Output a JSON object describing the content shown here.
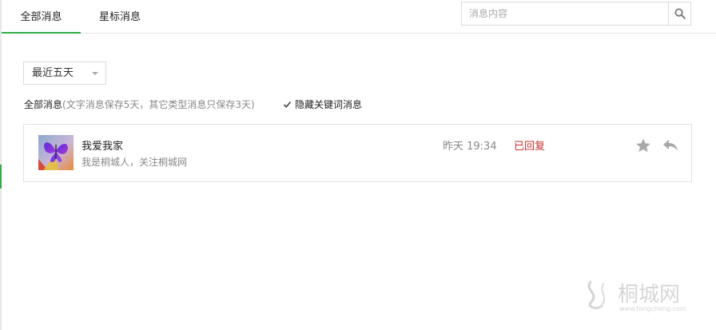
{
  "tabs": [
    {
      "label": "全部消息",
      "active": true
    },
    {
      "label": "星标消息",
      "active": false
    }
  ],
  "search": {
    "placeholder": "消息内容",
    "value": ""
  },
  "filter": {
    "range_selected": "最近五天",
    "title": "全部消息",
    "note": "(文字消息保存5天，其它类型消息只保存3天)",
    "hide_keyword_label": "隐藏关键词消息",
    "hide_keyword_checked": true
  },
  "messages": [
    {
      "sender": "我爱我家",
      "preview": "我是桐城人，关注桐城网",
      "time": "昨天 19:34",
      "status": "已回复"
    }
  ],
  "watermark": {
    "name": "桐城网",
    "url": "www.tongcheng.com"
  },
  "colors": {
    "accent": "#2fae45",
    "replied": "#c9302c",
    "muted": "#888888",
    "border": "#e2e2e2"
  },
  "icons": {
    "search": "search-icon",
    "star": "star-icon",
    "reply": "reply-icon",
    "check": "check-icon",
    "dropdown": "caret-down-icon"
  }
}
